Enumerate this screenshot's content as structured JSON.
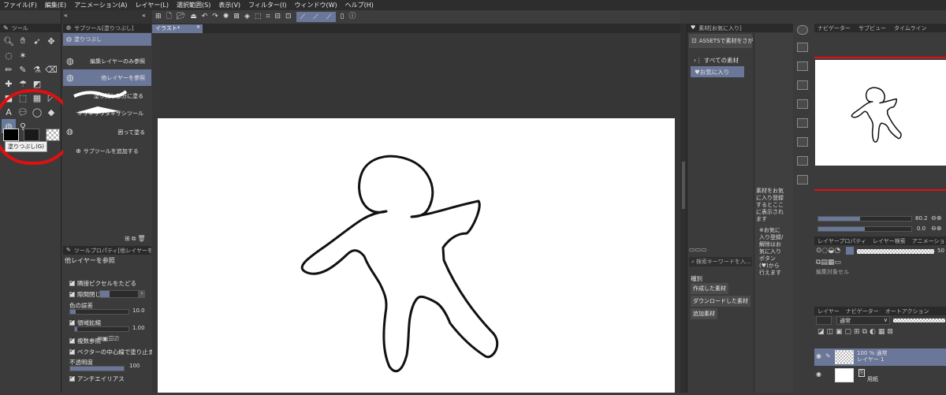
{
  "menu": [
    "ファイル(F)",
    "編集(E)",
    "アニメーション(A)",
    "レイヤー(L)",
    "選択範囲(S)",
    "表示(V)",
    "フィルター(I)",
    "ウィンドウ(W)",
    "ヘルプ(H)"
  ],
  "tool_palette": {
    "header": "ツール",
    "tooltip": "塗りつぶし(G)"
  },
  "sub_tool": {
    "header": "サブツール[塗りつぶし]",
    "group_tab": "塗りつぶし",
    "items": [
      "編集レイヤーのみ参照",
      "他レイヤーを参照",
      "塗り残し部分に塗る",
      "ギザギザワタギザシツール",
      "囲って塗る"
    ],
    "add_label": "サブツールを追加する"
  },
  "tool_property": {
    "header": "ツールプロパティ[他レイヤーを参照]",
    "title": "他レイヤーを参照",
    "rows": {
      "adjacent": "隣接ピクセルをたどる",
      "close_gap": "隙間閉じ",
      "color_margin": "色の誤差",
      "color_margin_value": "10.0",
      "area_scaling": "領域拡縮",
      "area_scaling_value": "1.00",
      "multi_ref": "複数参照",
      "vector_stop": "ベクターの中心線で塗り止まる",
      "opacity": "不透明度",
      "opacity_value": "100",
      "antialias": "アンチエイリアス"
    },
    "color_margin_level": 0.1,
    "area_scaling_level": 0.05,
    "opacity_level": 1.0
  },
  "canvas": {
    "tab_label": "イラスト*"
  },
  "material": {
    "header": "素材[お気に入り]",
    "assets_button": "ASSETSで素材をさがす",
    "all_materials": "すべての素材",
    "favorites": "お気に入り",
    "search_placeholder": "検索キーワードを入...",
    "category_label": "種別",
    "categories": [
      "作成した素材",
      "ダウンロードした素材",
      "追加素材"
    ],
    "hint": "素材をお気に入り登録するとここに表示されます",
    "hint2": "※お気に入り登録/解除はお気に入りボタン(♥)から行えます"
  },
  "navigator": {
    "tabs": [
      "ナビゲーター",
      "サブビュー",
      "タイムライン"
    ],
    "zoom": "80.2",
    "rotate": "0.0"
  },
  "layer": {
    "tabs": [
      "レイヤープロパティ",
      "レイヤー検索",
      "アニメーション"
    ],
    "blend_mode": "通常",
    "opacity_value": "50",
    "edit_target": "編集対象セル",
    "panel_tabs": [
      "レイヤー",
      "ナビゲーター",
      "オートアクション"
    ],
    "layers": [
      {
        "line1": "100 % 通常",
        "line2": "レイヤー 1",
        "selected": true
      },
      {
        "line1": "",
        "line2": "用紙",
        "selected": false
      }
    ]
  },
  "colors": {
    "selection": "#6b7799",
    "annotation": "#e01010",
    "panel": "#3b3b3b"
  }
}
